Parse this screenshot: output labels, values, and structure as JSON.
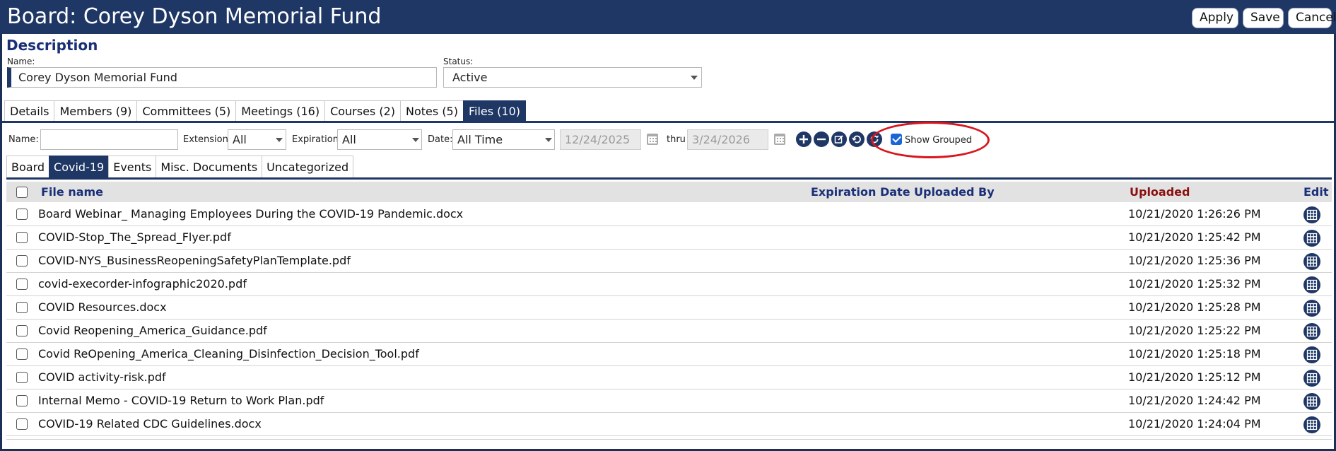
{
  "window": {
    "title": "Board: Corey Dyson Memorial Fund",
    "buttons": {
      "apply": "Apply",
      "save": "Save",
      "cancel": "Cancel"
    }
  },
  "description": {
    "section_title": "Description",
    "name_label": "Name:",
    "name_value": "Corey Dyson Memorial Fund",
    "status_label": "Status:",
    "status_value": "Active"
  },
  "tabs": [
    {
      "label": "Details",
      "active": false
    },
    {
      "label": "Members (9)",
      "active": false
    },
    {
      "label": "Committees (5)",
      "active": false
    },
    {
      "label": "Meetings (16)",
      "active": false
    },
    {
      "label": "Courses (2)",
      "active": false
    },
    {
      "label": "Notes (5)",
      "active": false
    },
    {
      "label": "Files (10)",
      "active": true
    }
  ],
  "filters": {
    "name_label": "Name:",
    "name_value": "",
    "extension_label": "Extension:",
    "extension_value": "All",
    "expiration_label": "Expiration:",
    "expiration_value": "All",
    "date_label": "Date:",
    "date_value": "All Time",
    "date_from": "12/24/2025",
    "thru_label": "thru",
    "date_to": "3/24/2026",
    "show_grouped_label": "Show Grouped",
    "show_grouped_checked": true
  },
  "subtabs": [
    {
      "label": "Board",
      "active": false
    },
    {
      "label": "Covid-19",
      "active": true
    },
    {
      "label": "Events",
      "active": false
    },
    {
      "label": "Misc. Documents",
      "active": false
    },
    {
      "label": "Uncategorized",
      "active": false
    }
  ],
  "table": {
    "columns": {
      "file_name": "File name",
      "expiration_date": "Expiration Date",
      "uploaded_by": "Uploaded By",
      "uploaded": "Uploaded",
      "edit": "Edit"
    },
    "rows": [
      {
        "file_name": "Board Webinar_ Managing Employees During the COVID-19 Pandemic.docx",
        "uploaded": "10/21/2020 1:26:26 PM"
      },
      {
        "file_name": "COVID-Stop_The_Spread_Flyer.pdf",
        "uploaded": "10/21/2020 1:25:42 PM"
      },
      {
        "file_name": "COVID-NYS_BusinessReopeningSafetyPlanTemplate.pdf",
        "uploaded": "10/21/2020 1:25:36 PM"
      },
      {
        "file_name": "covid-execorder-infographic2020.pdf",
        "uploaded": "10/21/2020 1:25:32 PM"
      },
      {
        "file_name": "COVID Resources.docx",
        "uploaded": "10/21/2020 1:25:28 PM"
      },
      {
        "file_name": "Covid Reopening_America_Guidance.pdf",
        "uploaded": "10/21/2020 1:25:22 PM"
      },
      {
        "file_name": "Covid ReOpening_America_Cleaning_Disinfection_Decision_Tool.pdf",
        "uploaded": "10/21/2020 1:25:18 PM"
      },
      {
        "file_name": "COVID activity-risk.pdf",
        "uploaded": "10/21/2020 1:25:12 PM"
      },
      {
        "file_name": "Internal Memo - COVID-19 Return to Work Plan.pdf",
        "uploaded": "10/21/2020 1:24:42 PM"
      },
      {
        "file_name": "COVID-19 Related CDC Guidelines.docx",
        "uploaded": "10/21/2020 1:24:04 PM"
      }
    ]
  },
  "colors": {
    "header_bg": "#1f3765",
    "heading_blue": "#1a2f78",
    "uploaded_red": "#8a1010",
    "highlight_oval": "#d8161c"
  },
  "icons": {
    "toolbar": [
      "add-icon",
      "remove-icon",
      "edit-icon",
      "undo-icon",
      "refresh-icon"
    ],
    "row_edit": "grid-icon",
    "date_picker": "calendar-icon"
  }
}
